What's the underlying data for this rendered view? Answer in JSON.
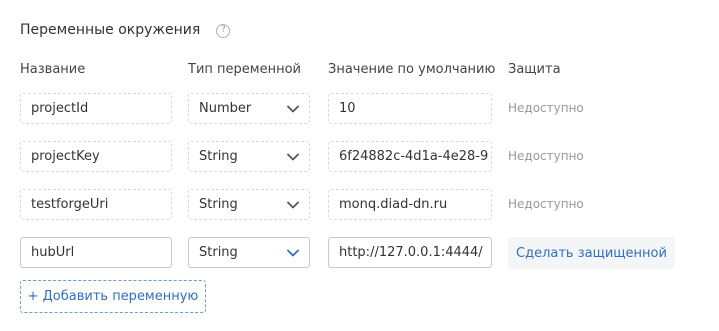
{
  "section": {
    "title": "Переменные окружения",
    "help_icon": "question-circle-icon"
  },
  "columns": {
    "name": "Название",
    "type": "Тип переменной",
    "default_value": "Значение по умолчанию",
    "protection": "Защита"
  },
  "rows": [
    {
      "name": "projectId",
      "type": "Number",
      "value": "10",
      "protection": "Недоступно"
    },
    {
      "name": "projectKey",
      "type": "String",
      "value": "6f24882c-4d1a-4e28-9",
      "protection": "Недоступно"
    },
    {
      "name": "testforgeUri",
      "type": "String",
      "value": "monq.diad-dn.ru",
      "protection": "Недоступно"
    },
    {
      "name": "hubUrl",
      "type": "String",
      "value": "http://127.0.0.1:4444/",
      "protection_action": "Сделать защищенной"
    }
  ],
  "add_button": "+ Добавить переменную",
  "colors": {
    "accent": "#2f6fc2",
    "chevron_default": "#555555",
    "chevron_active": "#2f6fc2",
    "muted_text": "#9a9a9a"
  }
}
